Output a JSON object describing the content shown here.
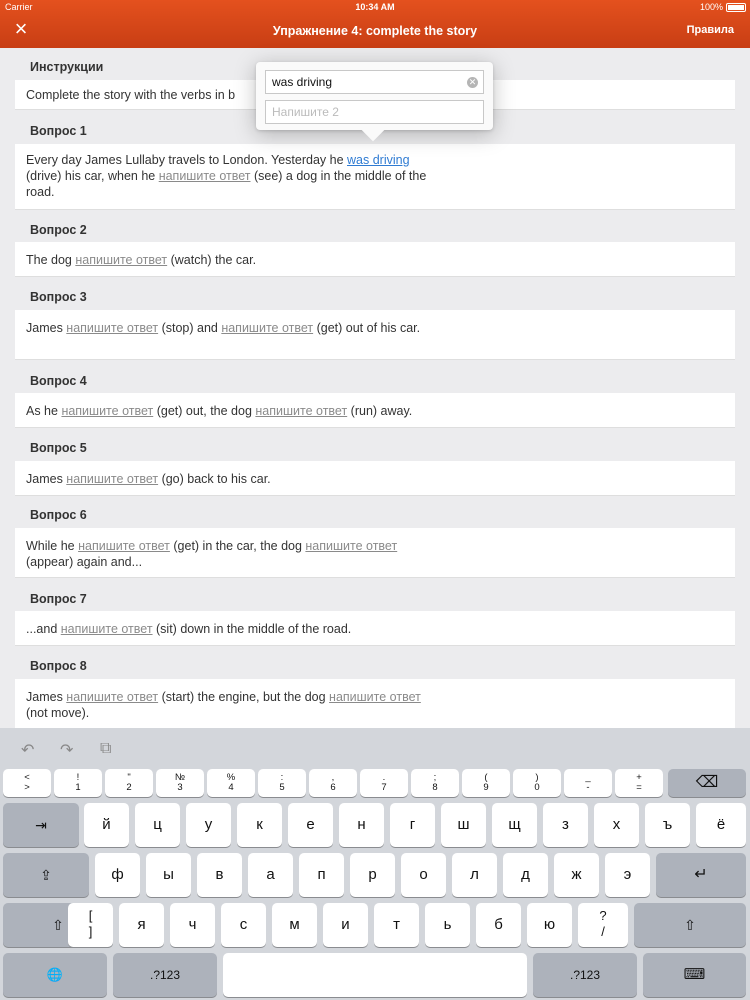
{
  "status_bar": {
    "carrier": "Carrier",
    "time": "10:34 AM",
    "battery": "100%"
  },
  "nav": {
    "close_icon": "×",
    "title": "Упражнение 4: complete the story",
    "rules_label": "Правила"
  },
  "instructions": {
    "heading": "Инструкции",
    "text": "Complete the story with the verbs in b"
  },
  "blank_placeholder": "напишите ответ",
  "questions": [
    {
      "label": "Вопрос 1",
      "parts": [
        "Every day James Lullaby travels to London. Yesterday he ",
        "was driving",
        " (drive) his car, when he ",
        "напишите ответ",
        " (see) a dog in the middle of the road."
      ]
    },
    {
      "label": "Вопрос 2",
      "parts": [
        "The dog ",
        "напишите ответ",
        " (watch) the car."
      ]
    },
    {
      "label": "Вопрос 3",
      "parts": [
        "James ",
        "напишите ответ",
        " (stop) and ",
        "напишите ответ",
        " (get) out of his car."
      ]
    },
    {
      "label": "Вопрос 4",
      "parts": [
        "As he ",
        "напишите ответ",
        " (get) out, the dog ",
        "напишите ответ",
        " (run) away."
      ]
    },
    {
      "label": "Вопрос 5",
      "parts": [
        "James ",
        "напишите ответ",
        " (go) back to his car."
      ]
    },
    {
      "label": "Вопрос 6",
      "parts": [
        "While he ",
        "напишите ответ",
        " (get) in the car, the dog ",
        "напишите ответ",
        " (appear) again and..."
      ]
    },
    {
      "label": "Вопрос 7",
      "parts": [
        "...and ",
        "напишите ответ",
        " (sit) down in the middle of the road."
      ]
    },
    {
      "label": "Вопрос 8",
      "parts": [
        "James ",
        "напишите ответ",
        " (start) the engine, but the dog ",
        "напишите ответ",
        " (not move)."
      ]
    }
  ],
  "popover": {
    "answer_value": "was driving",
    "second_placeholder": "Напишите 2"
  },
  "keyboard": {
    "toolbar": {
      "undo_icon": "↶",
      "redo_icon": "↷",
      "paste_icon": "⧉"
    },
    "number_row": [
      {
        "top": "<",
        "bottom": ">"
      },
      {
        "top": "!",
        "bottom": "1"
      },
      {
        "top": "\"",
        "bottom": "2"
      },
      {
        "top": "№",
        "bottom": "3"
      },
      {
        "top": "%",
        "bottom": "4"
      },
      {
        "top": ":",
        "bottom": "5"
      },
      {
        "top": ",",
        "bottom": "6"
      },
      {
        "top": ".",
        "bottom": "7"
      },
      {
        "top": ";",
        "bottom": "8"
      },
      {
        "top": "(",
        "bottom": "9"
      },
      {
        "top": ")",
        "bottom": "0"
      },
      {
        "top": "_",
        "bottom": "-"
      },
      {
        "top": "+",
        "bottom": "="
      }
    ],
    "backspace_icon": "⌫",
    "tab_icon": "⇥",
    "row1": [
      "й",
      "ц",
      "у",
      "к",
      "е",
      "н",
      "г",
      "ш",
      "щ",
      "з",
      "х",
      "ъ",
      "ё"
    ],
    "caps_icon": "⇪",
    "row2": [
      "ф",
      "ы",
      "в",
      "а",
      "п",
      "р",
      "о",
      "л",
      "д",
      "ж",
      "э"
    ],
    "return_icon": "↵",
    "shift_icon": "⇧",
    "bracket_key": {
      "top": "[",
      "bottom": "]"
    },
    "row3": [
      "я",
      "ч",
      "с",
      "м",
      "и",
      "т",
      "ь",
      "б",
      "ю"
    ],
    "question_key": {
      "top": "?",
      "bottom": "/"
    },
    "globe_icon": "🌐",
    "numbers_label": ".?123",
    "hide_icon": "⌨"
  }
}
